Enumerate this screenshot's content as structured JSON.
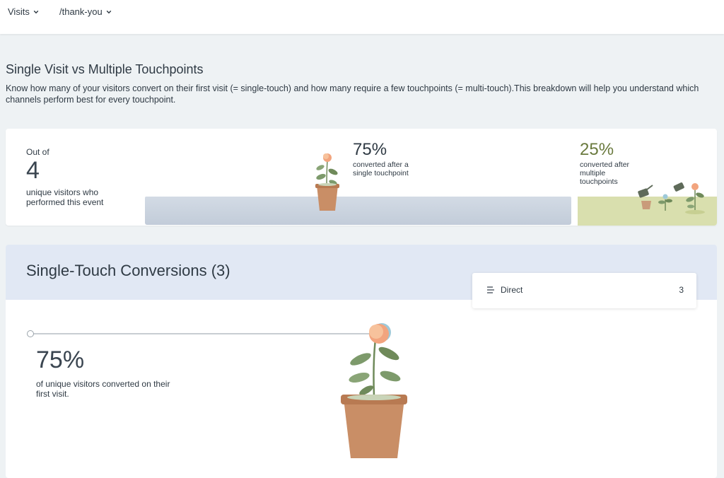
{
  "filters": {
    "metric": "Visits",
    "page": "/thank-you"
  },
  "section": {
    "title": "Single Visit vs Multiple Touchpoints",
    "description": "Know how many of your visitors convert on their first visit (= single-touch) and how many require a few touchpoints (= multi-touch).This breakdown will help you understand which channels perform best for every touchpoint."
  },
  "overview": {
    "out_of_label": "Out of",
    "visitors_count": "4",
    "visitors_desc": "unique visitors who performed this event",
    "single": {
      "percent": "75%",
      "desc": "converted after a single touchpoint",
      "share": 0.75
    },
    "multi": {
      "percent": "25%",
      "desc": "converted after multiple touchpoints",
      "share": 0.25
    }
  },
  "single_touch": {
    "title": "Single-Touch Conversions (3)",
    "channels": [
      {
        "name": "Direct",
        "count": "3"
      }
    ],
    "percent": "75%",
    "desc": "of unique visitors converted on their first visit."
  },
  "colors": {
    "accent_multi": "#6a7a3e",
    "single_bar": "#c9d2de",
    "multi_bar": "#d9dfae",
    "header_bg": "#e1e8f4"
  }
}
